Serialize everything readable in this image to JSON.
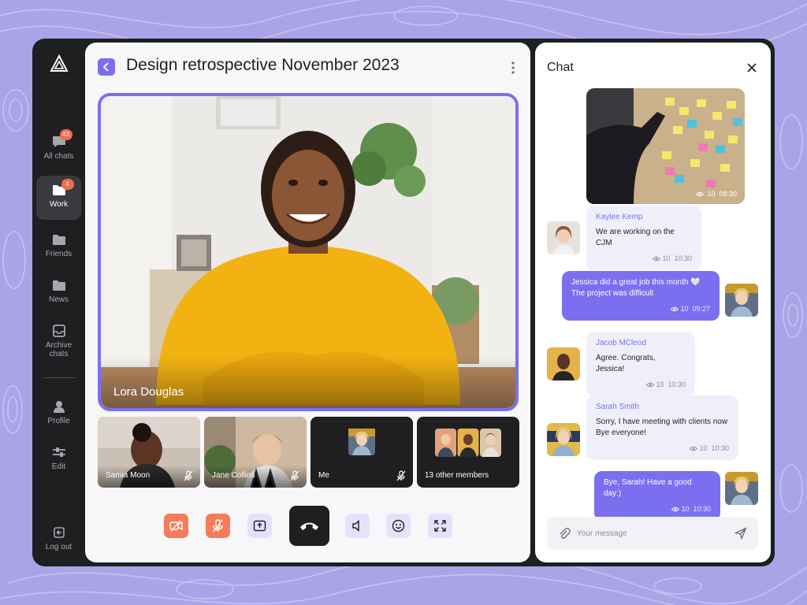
{
  "colors": {
    "accent": "#7b6ff0",
    "orange": "#f47c5a",
    "dark": "#1f1f22",
    "background": "#a9a4e6"
  },
  "sidebar": {
    "items": [
      {
        "label": "All chats",
        "badge": "43",
        "icon": "chat-bubble-icon"
      },
      {
        "label": "Work",
        "badge": "4",
        "icon": "folder-icon",
        "active": true
      },
      {
        "label": "Friends",
        "icon": "folder-icon"
      },
      {
        "label": "News",
        "icon": "folder-icon"
      },
      {
        "label": "Archive chats",
        "icon": "archive-icon"
      },
      {
        "label": "Profile",
        "icon": "user-icon"
      },
      {
        "label": "Edit",
        "icon": "sliders-icon"
      },
      {
        "label": "Log out",
        "icon": "logout-icon"
      }
    ]
  },
  "call": {
    "title": "Design retrospective November 2023",
    "speaker": "Lora Douglas",
    "participants": [
      {
        "name": "Samia Moon",
        "muted": true
      },
      {
        "name": "Jane Collins",
        "muted": true
      },
      {
        "name": "Me",
        "muted": true
      },
      {
        "name": "13 other members"
      }
    ],
    "controls": [
      "video-off-icon",
      "mic-off-icon",
      "share-screen-icon",
      "end-call-icon",
      "speaker-icon",
      "emoji-icon",
      "fullscreen-icon"
    ]
  },
  "chat": {
    "title": "Chat",
    "media": {
      "views": "10",
      "time": "08:30"
    },
    "messages": [
      {
        "sender": "Kaylee Kemp",
        "text": "We are working on the CJM",
        "views": "10",
        "time": "10:30",
        "direction": "in"
      },
      {
        "text": "Jessica did a great job this month 🤍\nThe project was difficult",
        "views": "10",
        "time": "09:27",
        "direction": "out"
      },
      {
        "sender": "Jacob MCleod",
        "text": "Agree. Congrats, Jessica!",
        "views": "10",
        "time": "10:30",
        "direction": "in"
      },
      {
        "sender": "Sarah Smith",
        "text": "Sorry, I have meeting with clients now\nBye everyone!",
        "views": "10",
        "time": "10:30",
        "direction": "in"
      },
      {
        "text": "Bye, Sarah! Have a good day:)",
        "views": "10",
        "time": "10:30",
        "direction": "out"
      }
    ],
    "composer": {
      "placeholder": "Your message",
      "value": ""
    }
  }
}
